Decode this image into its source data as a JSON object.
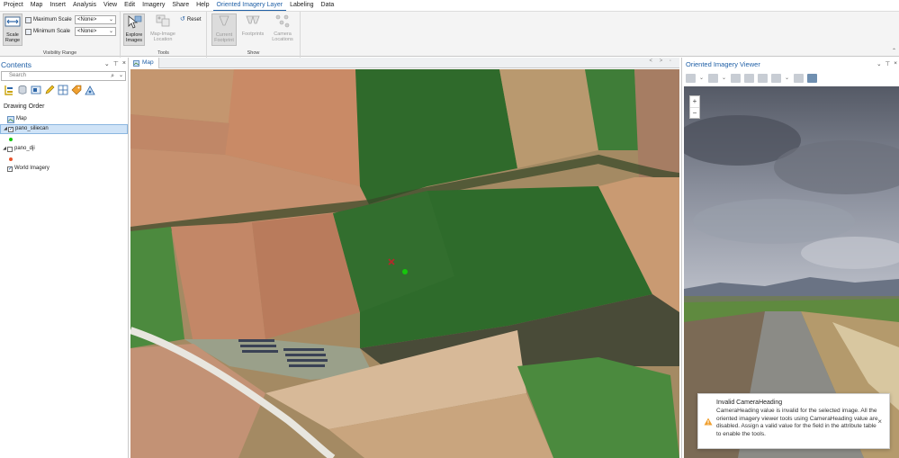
{
  "menu": {
    "items": [
      "Project",
      "Map",
      "Insert",
      "Analysis",
      "View",
      "Edit",
      "Imagery",
      "Share",
      "Help",
      "Oriented Imagery Layer",
      "Labeling",
      "Data"
    ],
    "active_index": 9
  },
  "ribbon": {
    "visibility": {
      "scale_range_label": "Scale Range",
      "maximum_scale_label": "Maximum Scale",
      "minimum_scale_label": "Minimum Scale",
      "maximum_scale_value": "<None>",
      "minimum_scale_value": "<None>",
      "group_label": "Visibility Range"
    },
    "tools": {
      "explore_images_label": "Explore Images",
      "map_image_location_label": "Map-Image Location",
      "reset_label": "Reset",
      "group_label": "Tools"
    },
    "show": {
      "current_footprint_label": "Current Footprint",
      "footprints_label": "Footprints",
      "camera_locations_label": "Camera Locations",
      "group_label": "Show"
    }
  },
  "contents": {
    "title": "Contents",
    "search_placeholder": "Search",
    "drawing_order": "Drawing Order",
    "layers": [
      {
        "name": "Map",
        "checked": true,
        "selected": false,
        "expander": "",
        "symbol": ""
      },
      {
        "name": "pano_siliecan",
        "checked": true,
        "selected": true,
        "expander": "◢",
        "symbol": "#16c60c"
      },
      {
        "name": "pano_dji",
        "checked": false,
        "selected": false,
        "expander": "◢",
        "symbol": "#e8532b"
      },
      {
        "name": "World Imagery",
        "checked": true,
        "selected": false,
        "expander": "",
        "symbol": ""
      }
    ]
  },
  "map": {
    "tab_label": "Map",
    "tab_nav": "< > ◦"
  },
  "viewer": {
    "title": "Oriented Imagery Viewer",
    "zoom_in": "+",
    "zoom_out": "−",
    "toast": {
      "title": "Invalid CameraHeading",
      "message": "CameraHeading value is invalid for the selected image. All the oriented imagery viewer tools using CameraHeading value are disabled. Assign a valid value for the field in the attribute table to enable the tools.",
      "close": "×"
    }
  },
  "pane_controls": {
    "menu": "⌄",
    "pin": "⊤",
    "close": "×"
  },
  "colors": {
    "accent": "#1f5fa6",
    "selection": "#cfe3f7",
    "warning": "#f0a030",
    "camera_point": "#16c60c",
    "selected_marker": "#b12a2a"
  }
}
